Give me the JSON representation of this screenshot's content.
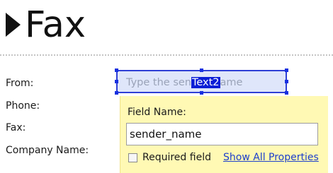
{
  "heading": {
    "title": "Fax"
  },
  "form": {
    "labels": {
      "from": "From:",
      "phone": "Phone:",
      "fax": "Fax:",
      "company": "Company Name:"
    },
    "selected_field": {
      "placeholder_before": "Type the sen",
      "tag": "Text2",
      "placeholder_after": "ame"
    }
  },
  "popup": {
    "field_name_label": "Field Name:",
    "field_name_value": "sender_name",
    "required_label": "Required field",
    "required_checked": false,
    "show_all_link": "Show All Properties"
  }
}
